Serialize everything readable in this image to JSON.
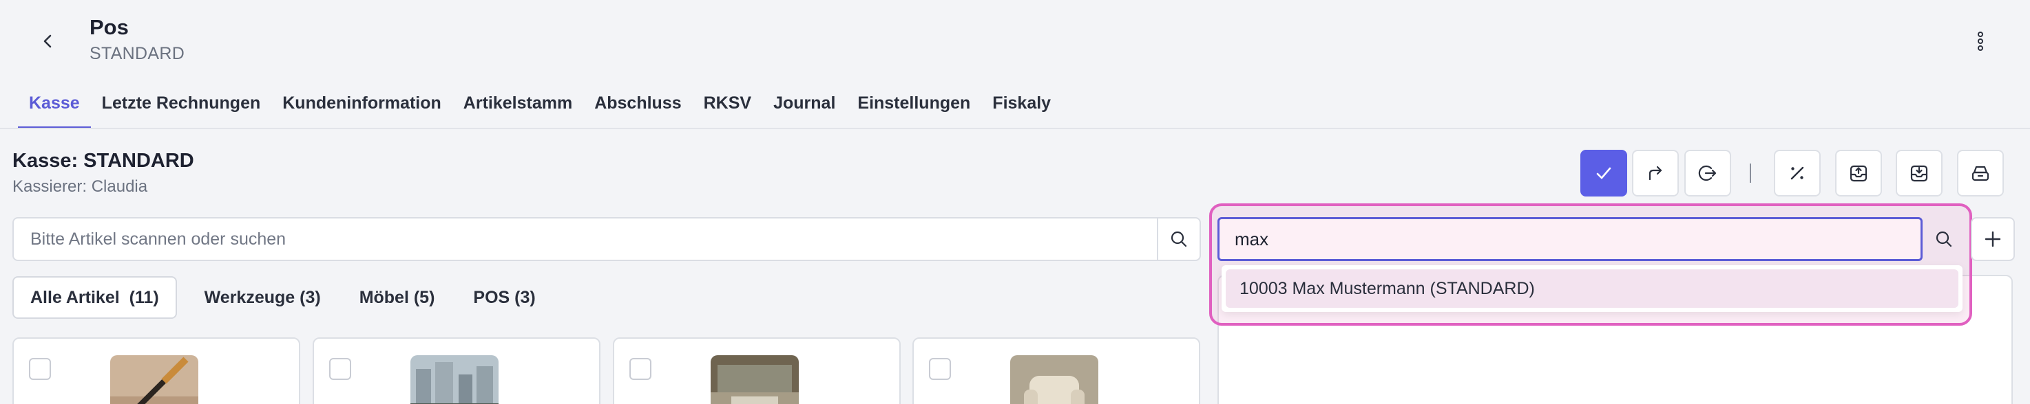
{
  "header": {
    "title": "Pos",
    "subtitle": "STANDARD"
  },
  "tabs": [
    {
      "label": "Kasse",
      "active": true
    },
    {
      "label": "Letzte Rechnungen"
    },
    {
      "label": "Kundeninformation"
    },
    {
      "label": "Artikelstamm"
    },
    {
      "label": "Abschluss"
    },
    {
      "label": "RKSV"
    },
    {
      "label": "Journal"
    },
    {
      "label": "Einstellungen"
    },
    {
      "label": "Fiskaly"
    }
  ],
  "register": {
    "title": "Kasse: STANDARD",
    "cashier": "Kassierer: Claudia"
  },
  "toolbar": {
    "icons": [
      "check-icon",
      "redirect-arrow-icon",
      "logout-icon",
      "percent-icon",
      "inbox-upload-icon",
      "inbox-download-icon",
      "cash-drawer-icon"
    ],
    "primary_color": "#5b5ee6"
  },
  "article_search": {
    "placeholder": "Bitte Artikel scannen oder suchen",
    "value": ""
  },
  "filters": [
    {
      "label": "Alle Artikel  (11)",
      "active": true
    },
    {
      "label": "Werkzeuge (3)"
    },
    {
      "label": "Möbel (5)"
    },
    {
      "label": "POS (3)"
    }
  ],
  "customer_search": {
    "value": "max",
    "results": [
      "10003 Max Mustermann (STANDARD)"
    ],
    "highlight_color": "#e060c0"
  },
  "product_cards": [
    {
      "image": "tool-brush-photo"
    },
    {
      "image": "balcony-city-photo"
    },
    {
      "image": "terrace-room-photo"
    },
    {
      "image": "armchair-photo"
    }
  ]
}
